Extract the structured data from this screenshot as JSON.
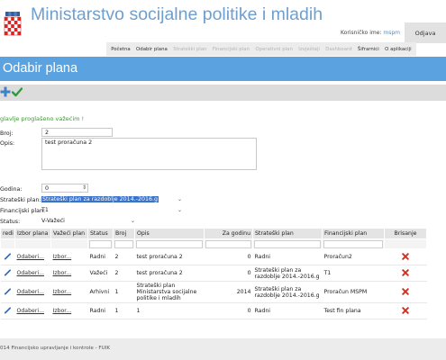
{
  "header": {
    "app_title": "Ministarstvo socijalne politike i mladih",
    "user_label": "Korisničko ime:",
    "username": "mspm",
    "logout_label": "Odjava"
  },
  "nav": [
    {
      "label": "Početna",
      "enabled": true
    },
    {
      "label": "Odabir plana",
      "enabled": true
    },
    {
      "label": "Strateški plan",
      "enabled": false
    },
    {
      "label": "Financijski plan",
      "enabled": false
    },
    {
      "label": "Operativni plan",
      "enabled": false
    },
    {
      "label": "Izvještaji",
      "enabled": false
    },
    {
      "label": "Dashboard",
      "enabled": false
    },
    {
      "label": "Šifrarnici",
      "enabled": true
    },
    {
      "label": "O aplikaciji",
      "enabled": true
    }
  ],
  "page": {
    "title": "Odabir plana",
    "success_message": "glavlje proglašeno važećim !"
  },
  "form": {
    "broj_label": "Broj:",
    "broj_value": "2",
    "opis_label": "Opis:",
    "opis_value": "test proračuna 2",
    "godina_label": "Godina:",
    "godina_value": "0",
    "strateski_label": "Strateški plan:",
    "strateski_value": "Strateški plan za razdoblje 2014.-2016.g",
    "financijski_label": "Financijski plan:",
    "financijski_value": "T1",
    "status_label": "Status:",
    "status_value": "V-Važeći"
  },
  "table": {
    "columns": [
      "redi",
      "Izbor plana",
      "Važeći plan",
      "Status",
      "Broj",
      "Opis",
      "Za godinu",
      "Strateški plan",
      "Financijski plan",
      "Brisanje"
    ],
    "rows": [
      {
        "izbor": "Odaberi...",
        "vazeci": "Izbor...",
        "status": "Radni",
        "broj": "2",
        "opis": "test proračuna 2",
        "godina": "0",
        "strateski": "Radni",
        "financijski": "Proračun2"
      },
      {
        "izbor": "Odaberi...",
        "vazeci": "Izbor...",
        "status": "Važeći",
        "broj": "2",
        "opis": "test proračuna 2",
        "godina": "0",
        "strateski": "Strateški plan za razdoblje 2014.-2016.g",
        "financijski": "T1"
      },
      {
        "izbor": "Odaberi...",
        "vazeci": "Izbor...",
        "status": "Arhivni",
        "broj": "1",
        "opis": "Strateški plan Ministarstva socijalne politike i mladih",
        "godina": "2014",
        "strateski": "Strateški plan za razdoblje 2014.-2016.g",
        "financijski": "Proračun MSPM"
      },
      {
        "izbor": "Odaberi...",
        "vazeci": "Izbor...",
        "status": "Radni",
        "broj": "1",
        "opis": "1",
        "godina": "0",
        "strateski": "Radni",
        "financijski": "Test fin plana"
      }
    ]
  },
  "footer": {
    "text": "014 Financijsko upravljanje i kontrole - FUIK"
  },
  "colors": {
    "accent": "#5ba3e0",
    "title": "#6e9fcf",
    "success": "#3a9a2e",
    "delete": "#d0311f",
    "edit": "#2f66b8"
  },
  "icons": {
    "add": "plus-icon",
    "confirm": "check-icon",
    "edit": "pencil-icon",
    "delete": "x-icon",
    "logo": "croatian-coat-of-arms"
  }
}
